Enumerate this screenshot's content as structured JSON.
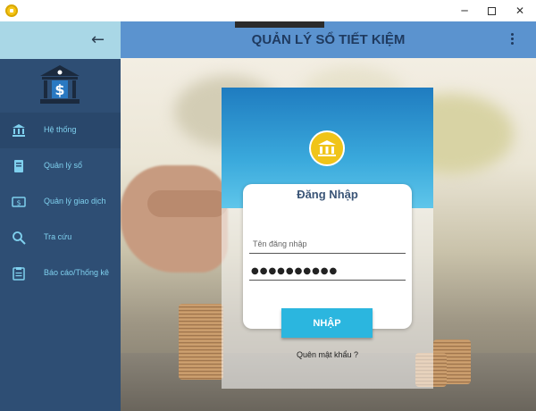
{
  "window": {
    "app_icon": "coin-icon",
    "controls": {
      "minimize": "─",
      "maximize": "square-icon",
      "close": "✕"
    }
  },
  "sidebar": {
    "back_icon": "arrow-left-icon",
    "logo_icon": "bank-dollar-icon",
    "items": [
      {
        "label": "Hệ thống",
        "icon": "bank-icon",
        "active": true
      },
      {
        "label": "Quản lý sổ",
        "icon": "book-icon",
        "active": false
      },
      {
        "label": "Quản lý giao dịch",
        "icon": "money-icon",
        "active": false
      },
      {
        "label": "Tra cứu",
        "icon": "search-icon",
        "active": false
      },
      {
        "label": "Báo cáo/Thống kê",
        "icon": "clipboard-icon",
        "active": false
      }
    ]
  },
  "header": {
    "title": "QUẢN LÝ SỔ TIẾT KIỆM",
    "menu_icon": "more-vertical-icon"
  },
  "login": {
    "icon": "bank-icon",
    "title": "Đăng Nhập",
    "username_placeholder": "Tên đăng nhập",
    "username_value": "",
    "password_value": "●●●●●●●●●●",
    "submit_label": "NHẬP",
    "forgot_label": "Quên mật khẩu ?"
  },
  "colors": {
    "sidebar_bg": "#2e4e74",
    "sidebar_head": "#a9d7e6",
    "header_bg": "#5b93cf",
    "accent": "#2bb6df",
    "nav_text": "#7fd0ee",
    "title_text": "#1f3a5f"
  }
}
